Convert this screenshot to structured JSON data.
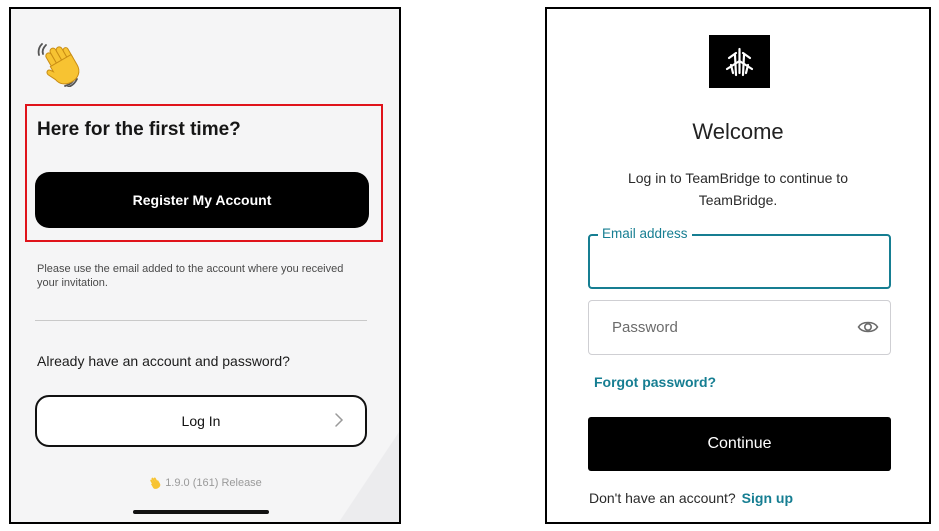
{
  "left_screen": {
    "heading": "Here for the first time?",
    "register_label": "Register My Account",
    "invitation_note": "Please use the email added to the account where you received your invitation.",
    "already_text": "Already have an account and password?",
    "login_label": "Log In",
    "version": "1.9.0 (161) Release",
    "icons": [
      "waving-hand-icon",
      "chevron-right-icon"
    ],
    "highlight_color": "#e0131b"
  },
  "right_screen": {
    "title": "Welcome",
    "subtitle": "Log in to TeamBridge to continue to TeamBridge.",
    "email_label": "Email address",
    "email_value": "",
    "password_placeholder": "Password",
    "forgot_label": "Forgot password?",
    "continue_label": "Continue",
    "no_account_text": "Don't have an account?",
    "signup_label": "Sign up",
    "accent_color": "#167e92",
    "icons": [
      "teambridge-logo",
      "eye-icon"
    ]
  }
}
